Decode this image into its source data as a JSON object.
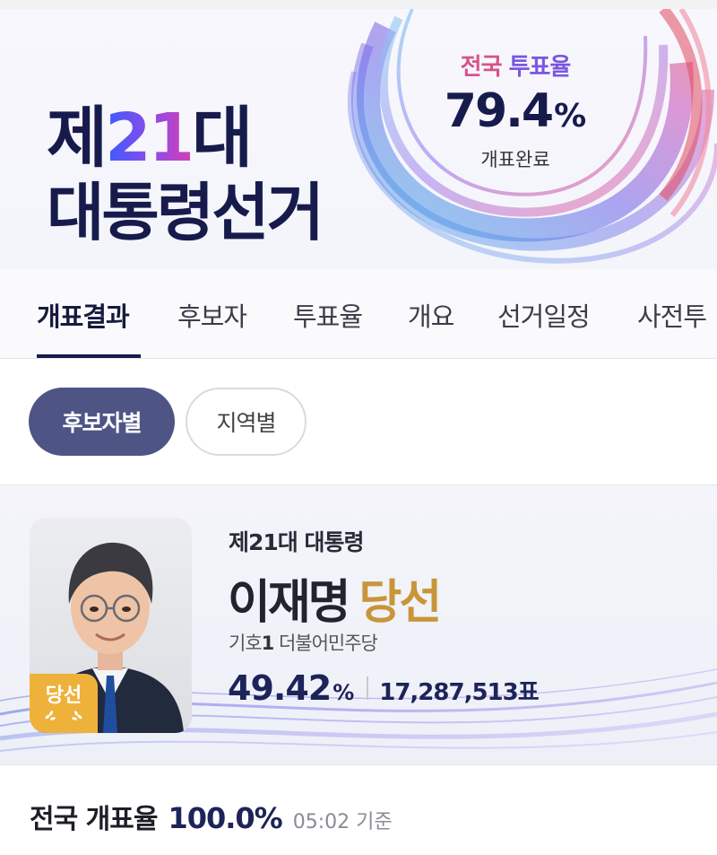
{
  "header": {
    "title_ordinal_prefix": "제",
    "title_ordinal_number": "21",
    "title_ordinal_suffix": "대",
    "title_line2": "대통령선거",
    "turnout": {
      "label_part1": "전국",
      "label_part2": "투표율",
      "value": "79.4",
      "unit": "%",
      "status": "개표완료"
    }
  },
  "tabs": [
    {
      "label": "개표결과",
      "active": true
    },
    {
      "label": "후보자",
      "active": false
    },
    {
      "label": "투표율",
      "active": false
    },
    {
      "label": "개요",
      "active": false
    },
    {
      "label": "선거일정",
      "active": false
    },
    {
      "label": "사전투",
      "active": false
    }
  ],
  "filters": {
    "by_candidate": "후보자별",
    "by_region": "지역별",
    "selected": "후보자별"
  },
  "winner": {
    "badge": "당선",
    "subtitle": "제21대 대통령",
    "name": "이재명",
    "result": "당선",
    "number_label": "기호",
    "number": "1",
    "party": "더불어민주당",
    "percent": "49.42",
    "percent_unit": "%",
    "votes": "17,287,513표"
  },
  "count": {
    "label": "전국 개표율",
    "value": "100.0%",
    "time": "05:02 기준"
  },
  "colors": {
    "navy": "#171b4c",
    "pill_active": "#4e5585",
    "gold": "#c8963a",
    "badge_orange": "#eeb13a"
  }
}
